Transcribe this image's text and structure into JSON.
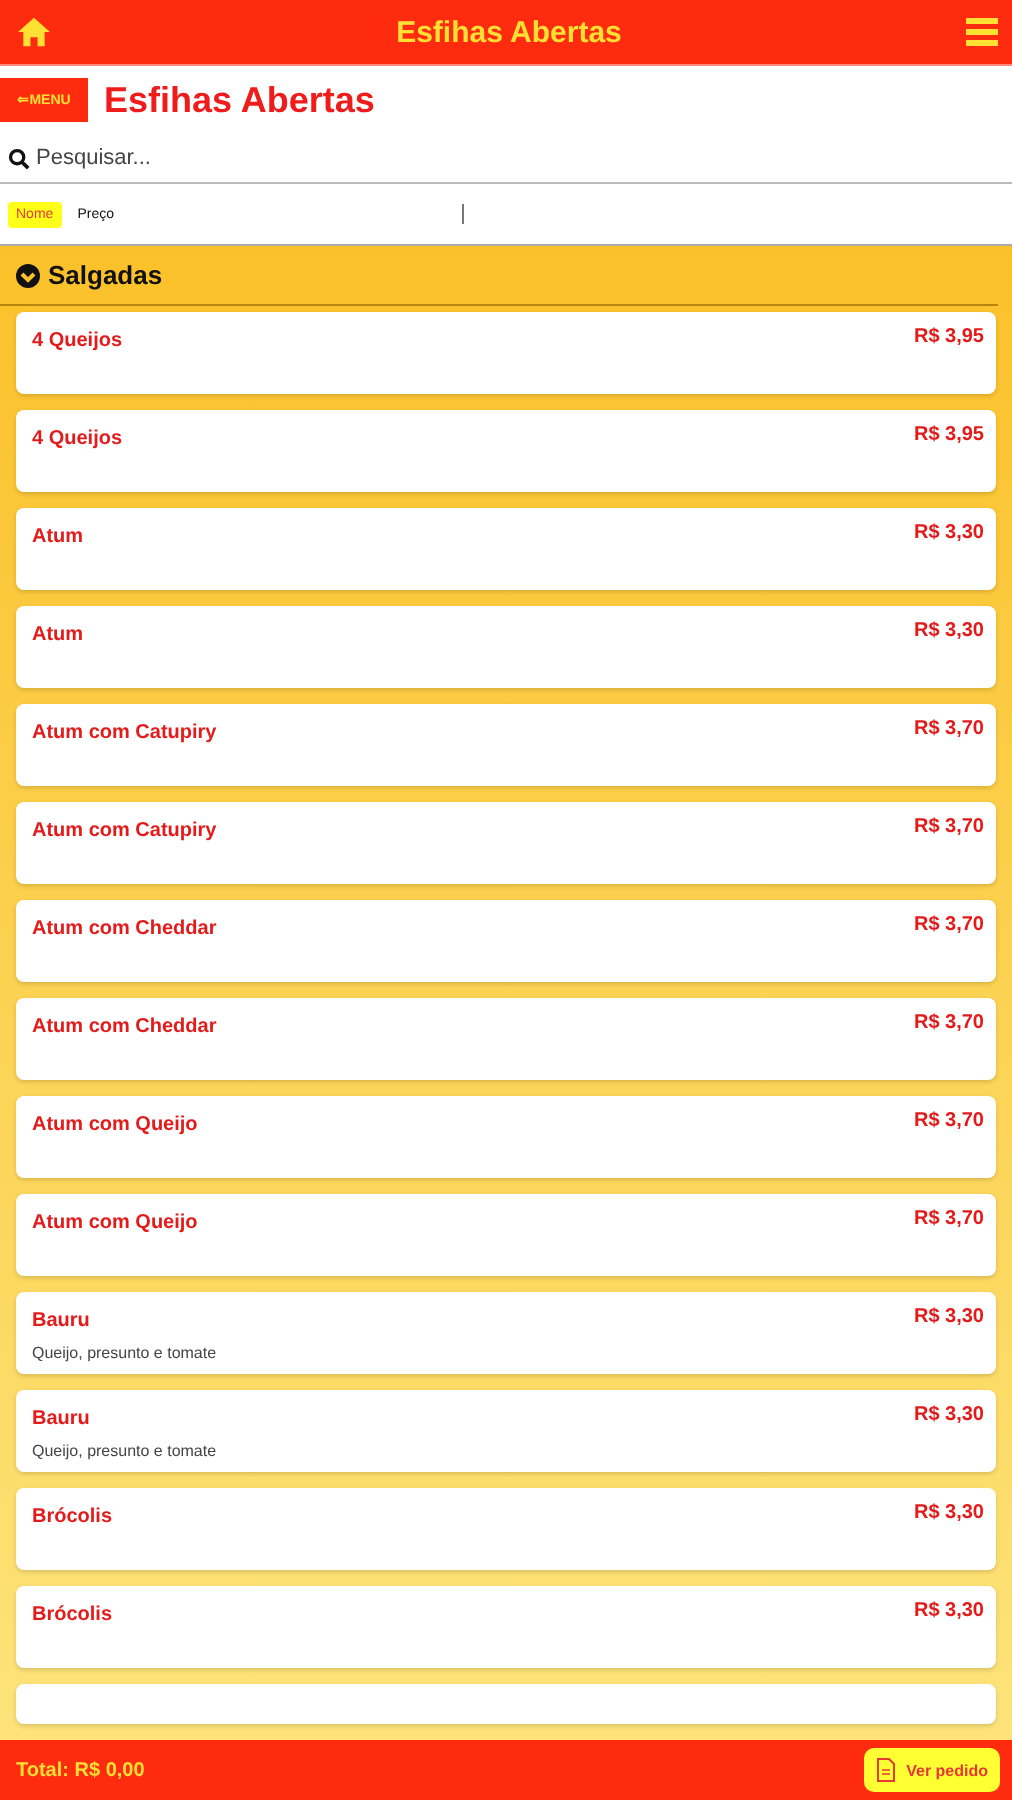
{
  "top_bar": {
    "title": "Esfihas Abertas"
  },
  "header": {
    "back_label": "⇐MENU",
    "title": "Esfihas Abertas"
  },
  "search": {
    "placeholder": "Pesquisar..."
  },
  "sort_tabs": [
    {
      "label": "Nome",
      "selected": true
    },
    {
      "label": "Preço",
      "selected": false
    }
  ],
  "section": {
    "title": "Salgadas",
    "expanded": true
  },
  "items": [
    {
      "name": "4 Queijos",
      "price": "R$ 3,95"
    },
    {
      "name": "4 Queijos",
      "price": "R$ 3,95"
    },
    {
      "name": "Atum",
      "price": "R$ 3,30"
    },
    {
      "name": "Atum",
      "price": "R$ 3,30"
    },
    {
      "name": "Atum com Catupiry",
      "price": "R$ 3,70"
    },
    {
      "name": "Atum com Catupiry",
      "price": "R$ 3,70"
    },
    {
      "name": "Atum com Cheddar",
      "price": "R$ 3,70"
    },
    {
      "name": "Atum com Cheddar",
      "price": "R$ 3,70"
    },
    {
      "name": "Atum com Queijo",
      "price": "R$ 3,70"
    },
    {
      "name": "Atum com Queijo",
      "price": "R$ 3,70"
    },
    {
      "name": "Bauru",
      "description": "Queijo, presunto e tomate",
      "price": "R$ 3,30"
    },
    {
      "name": "Bauru",
      "description": "Queijo, presunto e tomate",
      "price": "R$ 3,30"
    },
    {
      "name": "Brócolis",
      "price": "R$ 3,30"
    },
    {
      "name": "Brócolis",
      "price": "R$ 3,30"
    }
  ],
  "footer": {
    "total": "Total: R$ 0,00",
    "button": "Ver pedido"
  }
}
